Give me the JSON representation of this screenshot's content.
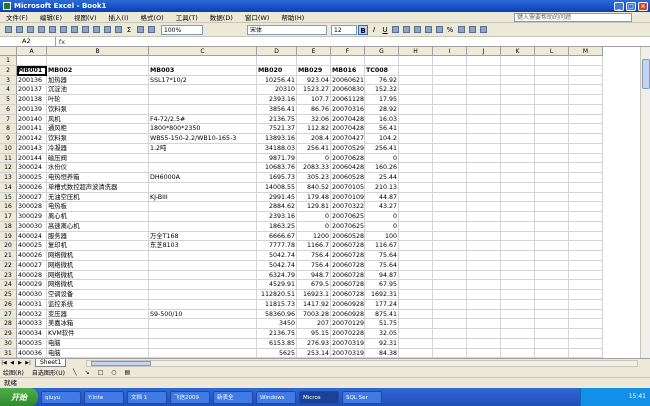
{
  "window": {
    "title": "Microsoft Excel - Book1"
  },
  "menu": [
    "文件(F)",
    "编辑(E)",
    "视图(V)",
    "插入(I)",
    "格式(O)",
    "工具(T)",
    "数据(D)",
    "窗口(W)",
    "帮助(H)"
  ],
  "help_search_placeholder": "键入需要帮助的问题",
  "toolbar": {
    "zoom": "100%",
    "font": "宋体",
    "font_size": "12",
    "bold": "B",
    "italic": "I",
    "underline": "U"
  },
  "formula_bar": {
    "name_box": "A2",
    "fx": "fx"
  },
  "columns": [
    "A",
    "B",
    "C",
    "D",
    "E",
    "F",
    "G",
    "H",
    "I",
    "J",
    "K",
    "L",
    "M"
  ],
  "rows": [
    {
      "n": "1",
      "a": "",
      "b": "",
      "c": "",
      "d": "",
      "e": "",
      "f": "",
      "g": ""
    },
    {
      "n": "2",
      "a": "MB001",
      "b": "MB002",
      "c": "MB003",
      "d": "MB020",
      "e": "MB029",
      "f": "MB016",
      "g": "TC008"
    },
    {
      "n": "3",
      "a": "200136",
      "b": "加热器",
      "c": "SSL17*10/2",
      "d": "10256.41",
      "e": "923.04",
      "f": "20060621",
      "g": "76.92"
    },
    {
      "n": "4",
      "a": "200137",
      "b": "沉淀池",
      "c": "",
      "d": "20310",
      "e": "1523.27",
      "f": "20060830",
      "g": "152.32"
    },
    {
      "n": "5",
      "a": "200138",
      "b": "叶轮",
      "c": "",
      "d": "2393.16",
      "e": "107.7",
      "f": "20061128",
      "g": "17.95"
    },
    {
      "n": "6",
      "a": "200139",
      "b": "饮料泵",
      "c": "",
      "d": "3856.41",
      "e": "86.76",
      "f": "20070316",
      "g": "28.92"
    },
    {
      "n": "7",
      "a": "200140",
      "b": "风机",
      "c": "F4-72/2.5#",
      "d": "2136.75",
      "e": "32.06",
      "f": "20070428",
      "g": "16.03"
    },
    {
      "n": "8",
      "a": "200141",
      "b": "通风柜",
      "c": "1800*800*2350",
      "d": "7521.37",
      "e": "112.82",
      "f": "20070428",
      "g": "56.41"
    },
    {
      "n": "9",
      "a": "200142",
      "b": "饮料泵",
      "c": "WBS5-150-2.2/WB10-165-3",
      "d": "13893.16",
      "e": "208.4",
      "f": "20070427",
      "g": "104.2"
    },
    {
      "n": "10",
      "a": "200143",
      "b": "冷凝器",
      "c": "1.2吨",
      "d": "34188.03",
      "e": "256.41",
      "f": "20070529",
      "g": "256.41"
    },
    {
      "n": "11",
      "a": "200144",
      "b": "磁压阀",
      "c": "",
      "d": "9871.79",
      "e": "0",
      "f": "20070628",
      "g": "0"
    },
    {
      "n": "12",
      "a": "300024",
      "b": "水份仪",
      "c": "",
      "d": "10683.76",
      "e": "2083.33",
      "f": "20060428",
      "g": "160.26"
    },
    {
      "n": "13",
      "a": "300025",
      "b": "电热恒养箱",
      "c": "DH6000A",
      "d": "1695.73",
      "e": "305.23",
      "f": "20060528",
      "g": "25.44"
    },
    {
      "n": "14",
      "a": "300026",
      "b": "单槽式数控超声波清洗器",
      "c": "",
      "d": "14008.55",
      "e": "840.52",
      "f": "20070105",
      "g": "210.13"
    },
    {
      "n": "15",
      "a": "300027",
      "b": "无油空压机",
      "c": "KJ-BIII",
      "d": "2991.45",
      "e": "179.48",
      "f": "20070109",
      "g": "44.87"
    },
    {
      "n": "16",
      "a": "300028",
      "b": "电热板",
      "c": "",
      "d": "2884.62",
      "e": "129.81",
      "f": "20070322",
      "g": "43.27"
    },
    {
      "n": "17",
      "a": "300029",
      "b": "离心机",
      "c": "",
      "d": "2393.16",
      "e": "0",
      "f": "20070625",
      "g": "0"
    },
    {
      "n": "18",
      "a": "300030",
      "b": "高速离心机",
      "c": "",
      "d": "1863.25",
      "e": "0",
      "f": "20070625",
      "g": "0"
    },
    {
      "n": "19",
      "a": "400024",
      "b": "服务器",
      "c": "万全T168",
      "d": "6666.67",
      "e": "1200",
      "f": "20060528",
      "g": "100"
    },
    {
      "n": "20",
      "a": "400025",
      "b": "复印机",
      "c": "东芝8103",
      "d": "7777.78",
      "e": "1166.7",
      "f": "20060728",
      "g": "116.67"
    },
    {
      "n": "21",
      "a": "400026",
      "b": "网络微机",
      "c": "",
      "d": "5042.74",
      "e": "756.4",
      "f": "20060728",
      "g": "75.64"
    },
    {
      "n": "22",
      "a": "400027",
      "b": "网络微机",
      "c": "",
      "d": "5042.74",
      "e": "756.4",
      "f": "20060728",
      "g": "75.64"
    },
    {
      "n": "23",
      "a": "400028",
      "b": "网络微机",
      "c": "",
      "d": "6324.79",
      "e": "948.7",
      "f": "20060728",
      "g": "94.87"
    },
    {
      "n": "24",
      "a": "400029",
      "b": "网络微机",
      "c": "",
      "d": "4529.91",
      "e": "679.5",
      "f": "20060728",
      "g": "67.95"
    },
    {
      "n": "25",
      "a": "400030",
      "b": "空调设备",
      "c": "",
      "d": "112820.51",
      "e": "16923.1",
      "f": "20060728",
      "g": "1692.31"
    },
    {
      "n": "26",
      "a": "400031",
      "b": "监控系统",
      "c": "",
      "d": "11815.73",
      "e": "1417.92",
      "f": "20060928",
      "g": "177.24"
    },
    {
      "n": "27",
      "a": "400032",
      "b": "变压器",
      "c": "S9-500/10",
      "d": "58360.96",
      "e": "7003.28",
      "f": "20060928",
      "g": "875.41"
    },
    {
      "n": "28",
      "a": "400033",
      "b": "美嘉冰箱",
      "c": "",
      "d": "3450",
      "e": "207",
      "f": "20070129",
      "g": "51.75"
    },
    {
      "n": "29",
      "a": "400034",
      "b": "KVM软件",
      "c": "",
      "d": "2136.75",
      "e": "95.15",
      "f": "20070228",
      "g": "32.05"
    },
    {
      "n": "30",
      "a": "400035",
      "b": "电脑",
      "c": "",
      "d": "6153.85",
      "e": "276.93",
      "f": "20070319",
      "g": "92.31"
    },
    {
      "n": "31",
      "a": "400036",
      "b": "电脑",
      "c": "",
      "d": "5625",
      "e": "253.14",
      "f": "20070319",
      "g": "84.38"
    }
  ],
  "sheet_tab": "Sheet1",
  "drawbar": [
    "绘图(R)",
    "自选图形(U)"
  ],
  "status": "就绪",
  "taskbar": {
    "start": "开始",
    "tasks": [
      "qiuyu",
      "Y:Inte",
      "文档 1",
      "飞信2009",
      "新表全",
      "Windows",
      "Micros",
      "SQL Ser"
    ],
    "clock": "15:41"
  }
}
